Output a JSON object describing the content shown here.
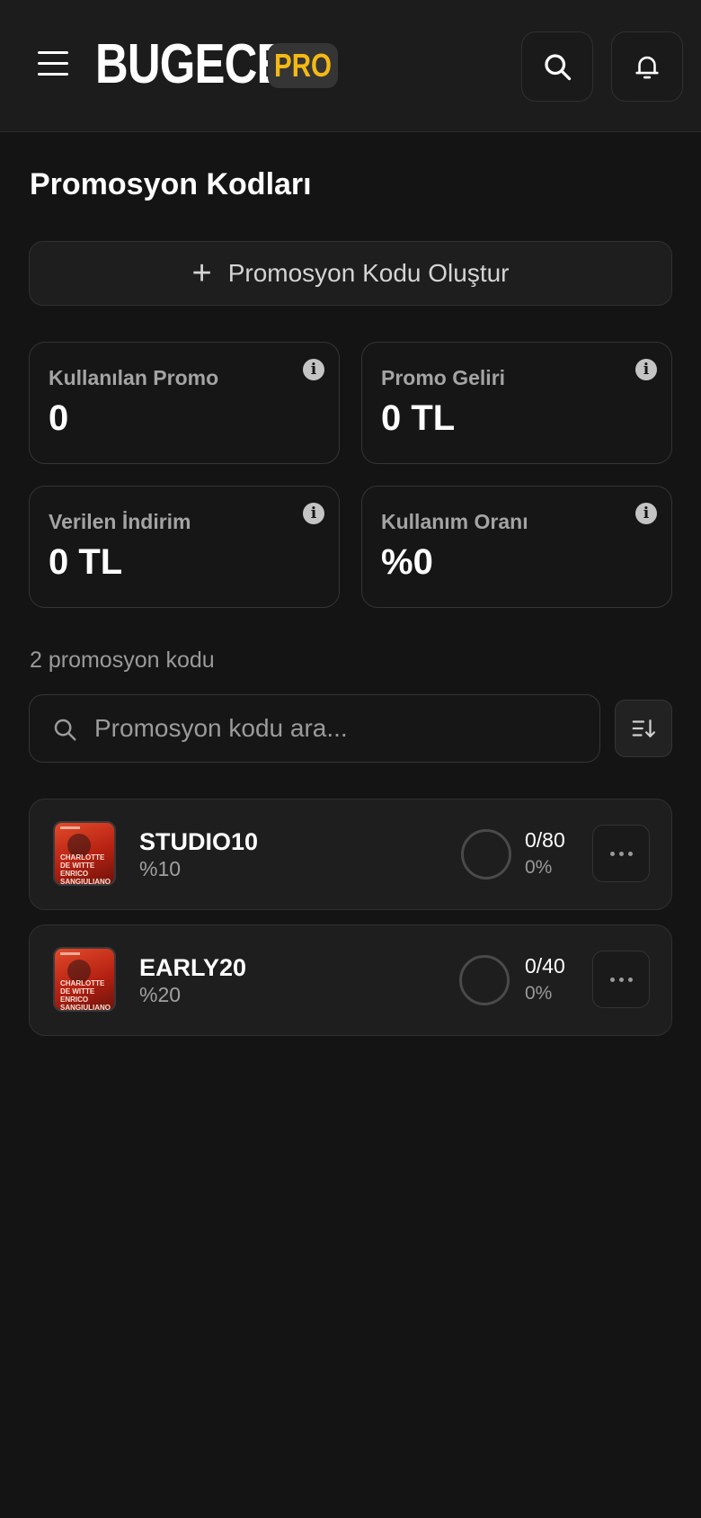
{
  "header": {
    "logo": "BUGECE",
    "badge": "PRO",
    "icons": [
      "menu-icon",
      "search-icon",
      "bell-icon"
    ]
  },
  "page": {
    "title": "Promosyon Kodları",
    "create_label": "Promosyon Kodu Oluştur"
  },
  "stats": [
    {
      "label": "Kullanılan Promo",
      "value": "0"
    },
    {
      "label": "Promo Geliri",
      "value": "0 TL"
    },
    {
      "label": "Verilen İndirim",
      "value": "0 TL"
    },
    {
      "label": "Kullanım Oranı",
      "value": "%0"
    }
  ],
  "list": {
    "count_text": "2 promosyon kodu",
    "search_placeholder": "Promosyon kodu ara..."
  },
  "promos": [
    {
      "code": "STUDIO10",
      "discount": "%10",
      "usage": "0/80",
      "percent": "0%",
      "thumb_text": "CHARLOTTE DE WITTE ENRICO SANGIULIANO"
    },
    {
      "code": "EARLY20",
      "discount": "%20",
      "usage": "0/40",
      "percent": "0%",
      "thumb_text": "CHARLOTTE DE WITTE ENRICO SANGIULIANO"
    }
  ],
  "colors": {
    "background": "#141414",
    "header": "#1c1c1c",
    "accent": "#f5b914"
  }
}
